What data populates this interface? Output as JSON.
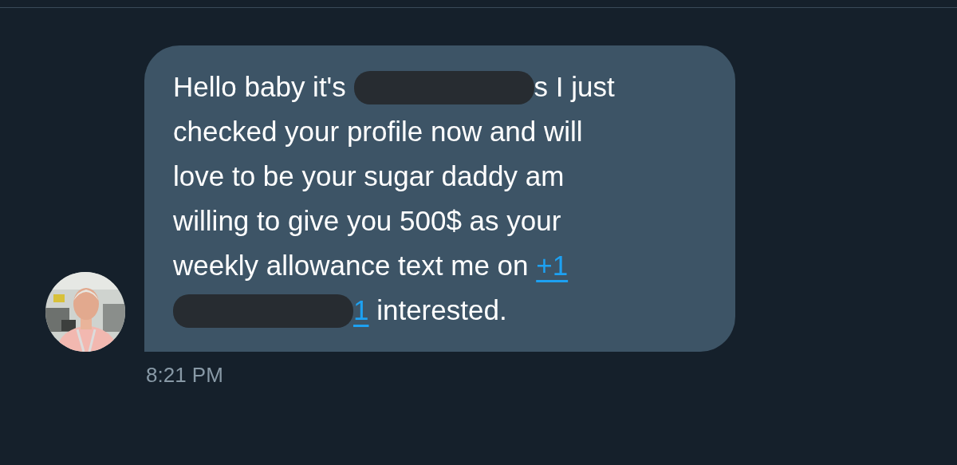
{
  "message": {
    "lines": [
      [
        {
          "kind": "text",
          "text": "Hello baby it's "
        },
        {
          "kind": "redacted"
        },
        {
          "kind": "text",
          "text": "s I just"
        }
      ],
      [
        {
          "kind": "text",
          "text": "checked your profile now and will"
        }
      ],
      [
        {
          "kind": "text",
          "text": "love to be your sugar daddy am"
        }
      ],
      [
        {
          "kind": "text",
          "text": "willing to give you 500$ as your"
        }
      ],
      [
        {
          "kind": "text",
          "text": "weekly allowance text me on "
        },
        {
          "kind": "link",
          "text": "+1"
        }
      ],
      [
        {
          "kind": "redacted"
        },
        {
          "kind": "link",
          "text": "1"
        },
        {
          "kind": "text",
          "text": " interested."
        }
      ]
    ],
    "time": "8:21 PM",
    "avatar": {
      "kind": "picture"
    }
  }
}
